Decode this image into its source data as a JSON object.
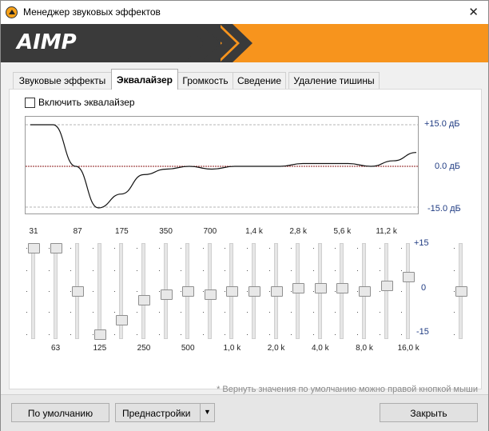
{
  "window": {
    "title": "Менеджер звуковых эффектов",
    "close_glyph": "✕"
  },
  "banner": {
    "logo": "AIMP"
  },
  "tabs": [
    {
      "label": "Звуковые эффекты",
      "active": false
    },
    {
      "label": "Эквалайзер",
      "active": true
    },
    {
      "label": "Громкость",
      "active": false
    },
    {
      "label": "Сведение",
      "active": false
    },
    {
      "label": "Удаление тишины",
      "active": false
    }
  ],
  "equalizer": {
    "enable_label": "Включить эквалайзер",
    "enabled": false,
    "graph_labels": {
      "top": "+15.0 дБ",
      "mid": "0.0 дБ",
      "bottom": "-15.0 дБ"
    },
    "scale_labels": {
      "top": "+15",
      "mid": "0",
      "bottom": "-15"
    },
    "bands": [
      {
        "label": "31",
        "gain": 15
      },
      {
        "label": "63",
        "gain": 15
      },
      {
        "label": "87",
        "gain": 0
      },
      {
        "label": "125",
        "gain": -15
      },
      {
        "label": "175",
        "gain": -10
      },
      {
        "label": "250",
        "gain": -3
      },
      {
        "label": "350",
        "gain": -1
      },
      {
        "label": "500",
        "gain": 0
      },
      {
        "label": "700",
        "gain": -1
      },
      {
        "label": "1,0 k",
        "gain": 0
      },
      {
        "label": "1,4 k",
        "gain": 0
      },
      {
        "label": "2,0 k",
        "gain": 0
      },
      {
        "label": "2,8 k",
        "gain": 1
      },
      {
        "label": "4,0 k",
        "gain": 1
      },
      {
        "label": "5,6 k",
        "gain": 1
      },
      {
        "label": "8,0 k",
        "gain": 0
      },
      {
        "label": "11,2 k",
        "gain": 2
      },
      {
        "label": "16,0 k",
        "gain": 5
      }
    ],
    "preamp_gain": 0,
    "hint": "* Вернуть значения по умолчанию можно правой кнопкой мыши"
  },
  "footer": {
    "default_label": "По умолчанию",
    "presets_label": "Преднастройки",
    "presets_arrow": "▼",
    "close_label": "Закрыть"
  },
  "colors": {
    "banner_orange": "#f7941d",
    "banner_dark": "#3a3a3a",
    "scale_blue": "#1f3b82",
    "zero_line": "#8b1a1a"
  }
}
